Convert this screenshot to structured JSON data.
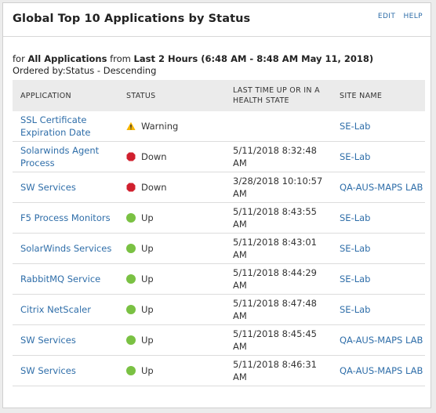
{
  "widget": {
    "title": "Global Top 10 Applications by Status",
    "edit_label": "EDIT",
    "help_label": "HELP"
  },
  "summary": {
    "for_prefix": "for",
    "scope": "All Applications",
    "from_word": "from",
    "range": "Last 2 Hours (6:48 AM - 8:48 AM May 11, 2018)",
    "ordered_by": "Ordered by:Status - Descending"
  },
  "table": {
    "headers": {
      "application": "APPLICATION",
      "status": "STATUS",
      "last_time": "LAST TIME UP OR IN A HEALTH STATE",
      "site": "SITE NAME"
    },
    "rows": [
      {
        "application": "SSL Certificate Expiration Date",
        "status": "Warning",
        "status_icon": "warning-icon",
        "last_time": "",
        "site": "SE-Lab"
      },
      {
        "application": "Solarwinds Agent Process",
        "status": "Down",
        "status_icon": "down-icon",
        "last_time": "5/11/2018 8:32:48 AM",
        "site": "SE-Lab"
      },
      {
        "application": "SW Services",
        "status": "Down",
        "status_icon": "down-icon",
        "last_time": "3/28/2018 10:10:57 AM",
        "site": "QA-AUS-MAPS LAB"
      },
      {
        "application": "F5 Process Monitors",
        "status": "Up",
        "status_icon": "up-icon",
        "last_time": "5/11/2018 8:43:55 AM",
        "site": "SE-Lab"
      },
      {
        "application": "SolarWinds Services",
        "status": "Up",
        "status_icon": "up-icon",
        "last_time": "5/11/2018 8:43:01 AM",
        "site": "SE-Lab"
      },
      {
        "application": "RabbitMQ Service",
        "status": "Up",
        "status_icon": "up-icon",
        "last_time": "5/11/2018 8:44:29 AM",
        "site": "SE-Lab"
      },
      {
        "application": "Citrix NetScaler",
        "status": "Up",
        "status_icon": "up-icon",
        "last_time": "5/11/2018 8:47:48 AM",
        "site": "SE-Lab"
      },
      {
        "application": "SW Services",
        "status": "Up",
        "status_icon": "up-icon",
        "last_time": "5/11/2018 8:45:45 AM",
        "site": "QA-AUS-MAPS LAB"
      },
      {
        "application": "SW Services",
        "status": "Up",
        "status_icon": "up-icon",
        "last_time": "5/11/2018 8:46:31 AM",
        "site": "QA-AUS-MAPS LAB"
      }
    ]
  },
  "colors": {
    "link": "#2f6ea9",
    "up": "#7ac143",
    "down": "#d0202e",
    "warning": "#f5b400"
  }
}
